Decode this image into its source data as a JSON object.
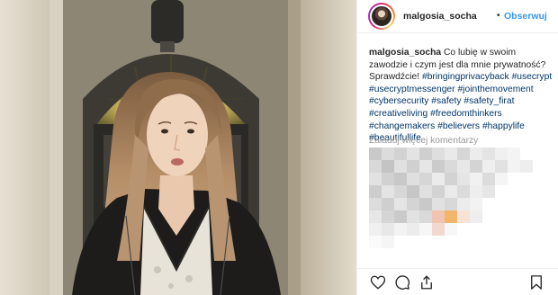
{
  "post": {
    "username": "malgosia_socha",
    "separator": "•",
    "follow_label": "Obserwuj",
    "caption": {
      "username": "malgosia_socha",
      "text": "Co lubię w swoim zawodzie i czym jest dla mnie prywatność? Sprawdźcie!",
      "hashtags": [
        "#bringingprivacyback",
        "#usecrypt",
        "#usecryptmessenger",
        "#jointhemovement",
        "#cybersecurity",
        "#safety",
        "#safety_firat",
        "#creativeliving",
        "#freedomthinkers",
        "#changemakers",
        "#believers",
        "#happylife",
        "#beautifullife"
      ]
    },
    "load_more_comments": "Załaduj więcej komentarzy"
  },
  "icons": {
    "like": "heart-icon",
    "comment": "comment-icon",
    "share": "share-icon",
    "save": "bookmark-icon"
  },
  "colors": {
    "link": "#3897f0",
    "hashtag": "#003569",
    "text": "#262626",
    "muted": "#999999"
  }
}
